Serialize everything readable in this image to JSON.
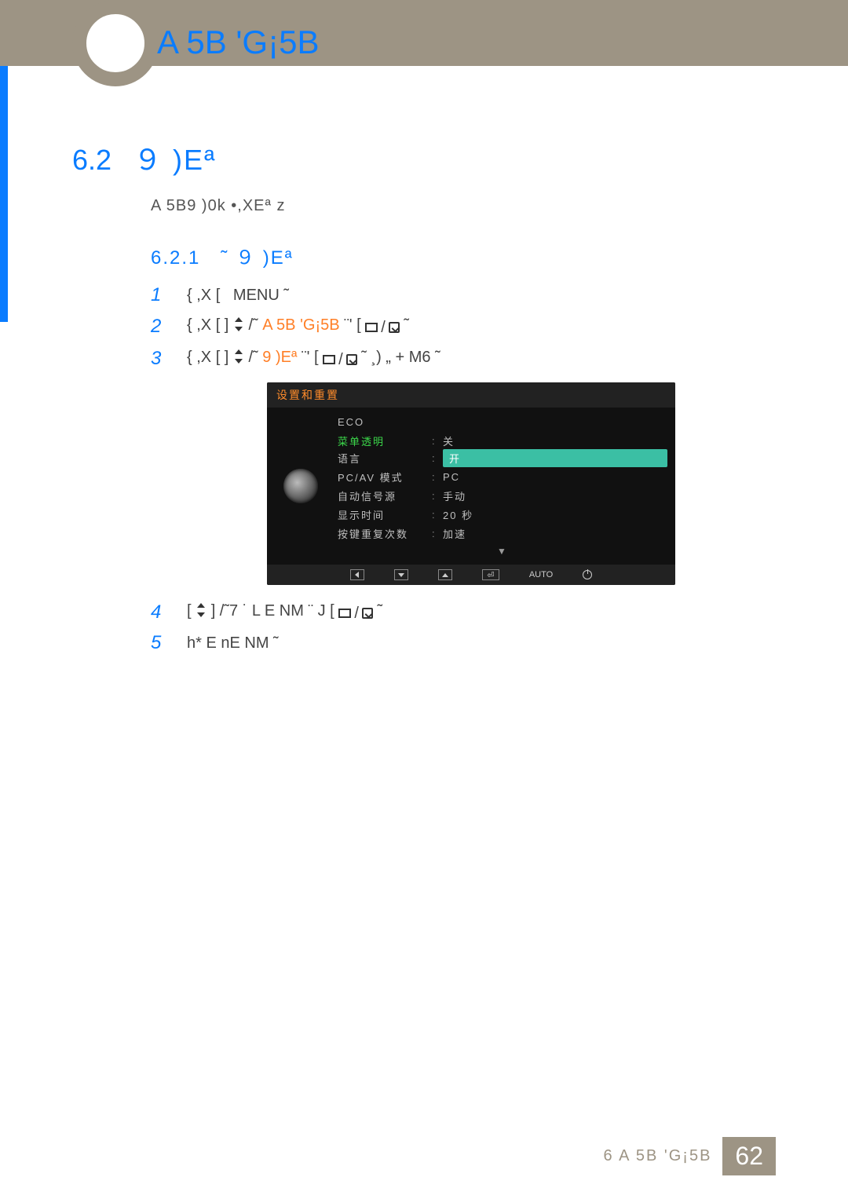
{
  "header": {
    "chapter_title": "A 5B 'G¡5B"
  },
  "section": {
    "num": "6.2",
    "title": "９ )Eª",
    "description": "A 5B9  )0k •,XEª   z"
  },
  "subsection": {
    "num": "6.2.1",
    "title": "˜  ９  )Eª"
  },
  "steps": [
    {
      "n": "1",
      "pre": "{   ,X [",
      "btn": "MENU",
      "post": "˜"
    },
    {
      "n": "2",
      "pre": "{   ,X [      ]",
      "updown": true,
      "mid": " /˜ ",
      "hl": "A 5B 'G¡5B",
      "post": "  ¨'     [",
      "sel": true,
      "tail": "˜"
    },
    {
      "n": "3",
      "pre": "{   ,X [      ]",
      "updown": true,
      "mid": " /˜ ",
      "hl": "9  )Eª",
      "post": "        ¨'      [",
      "sel": true,
      "tail": "˜ ¸)  „  + M6 ˜"
    },
    {
      "n": "4",
      "pre": "[",
      "updown": true,
      "mid": "] /˜7 ˙ L E NM ¨ J   [",
      "sel": true,
      "tail": "˜"
    },
    {
      "n": "5",
      "pre": "h* E   nE NM ˜"
    }
  ],
  "osd": {
    "title": "设置和重置",
    "rows": [
      {
        "label": "ECO",
        "value": "",
        "green": false
      },
      {
        "label": "菜单透明",
        "value": "",
        "green": true,
        "opts": [
          "关",
          "开"
        ],
        "selected": "开"
      },
      {
        "label": "语言",
        "value": ""
      },
      {
        "label": "PC/AV 模式",
        "value": "PC"
      },
      {
        "label": "自动信号源",
        "value": "手动"
      },
      {
        "label": "显示时间",
        "value": "20 秒"
      },
      {
        "label": "按键重复次数",
        "value": "加速"
      }
    ],
    "bottom_auto": "AUTO"
  },
  "footer": {
    "label": "6 A 5B 'G¡5B",
    "page": "62"
  }
}
